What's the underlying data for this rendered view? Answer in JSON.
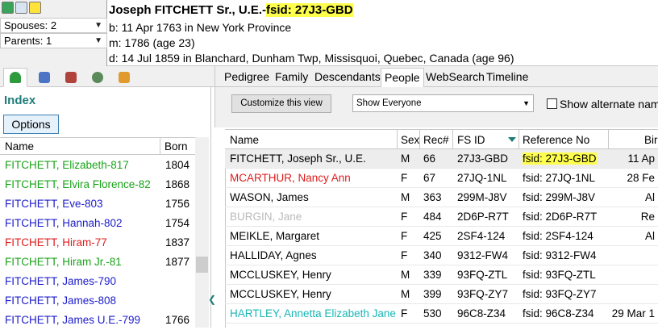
{
  "top_left": {
    "spouses_label": "Spouses: 2",
    "parents_label": "Parents: 1"
  },
  "header": {
    "name_prefix": "Joseph FITCHETT Sr., U.E.-",
    "fsid": "fsid: 27J3-GBD",
    "birth": "b: 11 Apr 1763 in New York Province",
    "marriage": "m: 1786 (age 23)",
    "death": "d: 14 Jul 1859 in Blanchard, Dunham Twp, Missisquoi, Quebec, Canada (age 96)"
  },
  "left_panel": {
    "title": "Index",
    "options_label": "Options",
    "col_name": "Name",
    "col_born": "Born",
    "rows": [
      {
        "name": "FITCHETT, Elizabeth-817",
        "born": "1804",
        "color": "#1aa31a"
      },
      {
        "name": "FITCHETT, Elvira Florence-82",
        "born": "1868",
        "color": "#1aa31a"
      },
      {
        "name": "FITCHETT, Eve-803",
        "born": "1756",
        "color": "#1c1ccc"
      },
      {
        "name": "FITCHETT, Hannah-802",
        "born": "1754",
        "color": "#1c1ccc"
      },
      {
        "name": "FITCHETT, Hiram-77",
        "born": "1837",
        "color": "#e01b1b"
      },
      {
        "name": "FITCHETT, Hiram Jr.-81",
        "born": "1877",
        "color": "#1aa31a"
      },
      {
        "name": "FITCHETT, James-790",
        "born": "",
        "color": "#1c1ccc"
      },
      {
        "name": "FITCHETT, James-808",
        "born": "",
        "color": "#1c1ccc"
      },
      {
        "name": "FITCHETT, James U.E.-799",
        "born": "1766",
        "color": "#1c1ccc"
      }
    ]
  },
  "right_tabs": [
    "Pedigree",
    "Family",
    "Descendants",
    "People",
    "WebSearch",
    "Timeline"
  ],
  "toolbar": {
    "customize_label": "Customize this view",
    "filter_value": "Show Everyone",
    "alt_names_label": "Show alternate names"
  },
  "grid": {
    "headers": {
      "name": "Name",
      "sex": "Sex",
      "rec": "Rec#",
      "fsid": "FS ID",
      "ref": "Reference No",
      "birth": "Bir"
    },
    "rows": [
      {
        "name": "FITCHETT, Joseph Sr., U.E.",
        "sex": "M",
        "rec": "66",
        "fsid": "27J3-GBD",
        "ref": "fsid: 27J3-GBD",
        "birth": "11 Ap",
        "color": "#000000",
        "selected": true,
        "ref_highlight": true
      },
      {
        "name": "MCARTHUR, Nancy Ann",
        "sex": "F",
        "rec": "67",
        "fsid": "27JQ-1NL",
        "ref": "fsid: 27JQ-1NL",
        "birth": "28 Fe",
        "color": "#e01b1b",
        "selected": false,
        "ref_highlight": false
      },
      {
        "name": "WASON, James",
        "sex": "M",
        "rec": "363",
        "fsid": "299M-J8V",
        "ref": "fsid: 299M-J8V",
        "birth": "Al",
        "color": "#000000",
        "selected": false,
        "ref_highlight": false
      },
      {
        "name": "BURGIN, Jane",
        "sex": "F",
        "rec": "484",
        "fsid": "2D6P-R7T",
        "ref": "fsid: 2D6P-R7T",
        "birth": "Re",
        "color": "#b9b9b9",
        "selected": false,
        "ref_highlight": false
      },
      {
        "name": "MEIKLE, Margaret",
        "sex": "F",
        "rec": "425",
        "fsid": "2SF4-124",
        "ref": "fsid: 2SF4-124",
        "birth": "Al",
        "color": "#000000",
        "selected": false,
        "ref_highlight": false
      },
      {
        "name": "HALLIDAY, Agnes",
        "sex": "F",
        "rec": "340",
        "fsid": "9312-FW4",
        "ref": "fsid: 9312-FW4",
        "birth": "",
        "color": "#000000",
        "selected": false,
        "ref_highlight": false
      },
      {
        "name": "MCCLUSKEY, Henry",
        "sex": "M",
        "rec": "339",
        "fsid": "93FQ-ZTL",
        "ref": "fsid: 93FQ-ZTL",
        "birth": "",
        "color": "#000000",
        "selected": false,
        "ref_highlight": false
      },
      {
        "name": "MCCLUSKEY, Henry",
        "sex": "M",
        "rec": "399",
        "fsid": "93FQ-ZY7",
        "ref": "fsid: 93FQ-ZY7",
        "birth": "",
        "color": "#000000",
        "selected": false,
        "ref_highlight": false
      },
      {
        "name": "HARTLEY, Annetta Elizabeth Jane",
        "sex": "F",
        "rec": "530",
        "fsid": "96C8-Z34",
        "ref": "fsid: 96C8-Z34",
        "birth": "29 Mar 1",
        "color": "#1bb5b5",
        "selected": false,
        "ref_highlight": false
      }
    ]
  },
  "colors": {
    "accent": "#1f7d7a",
    "highlight": "#ffff4d"
  }
}
